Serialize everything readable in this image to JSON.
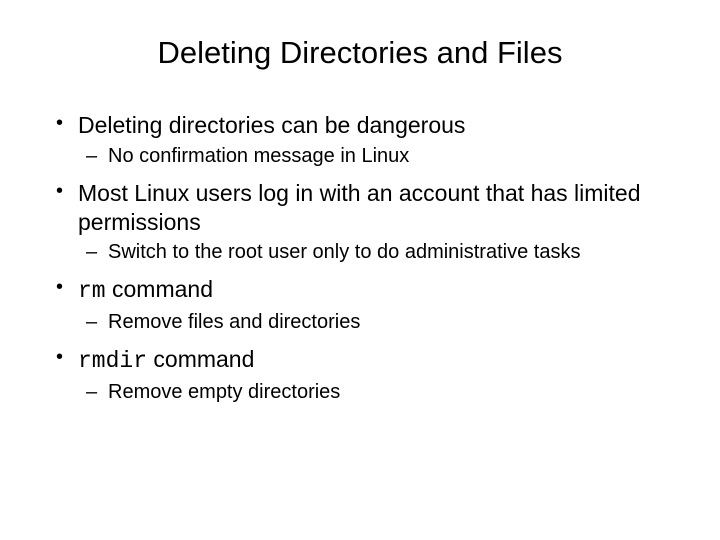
{
  "title": "Deleting Directories and Files",
  "bullets": {
    "b1": "Deleting directories can be dangerous",
    "b1s1": "No confirmation message in Linux",
    "b2": "Most Linux users log in with an account that has limited permissions",
    "b2s1": "Switch to the root user only to do administrative tasks",
    "b3_code": "rm",
    "b3_rest": " command",
    "b3s1": "Remove files and directories",
    "b4_code": "rmdir",
    "b4_rest": " command",
    "b4s1": "Remove empty directories"
  }
}
